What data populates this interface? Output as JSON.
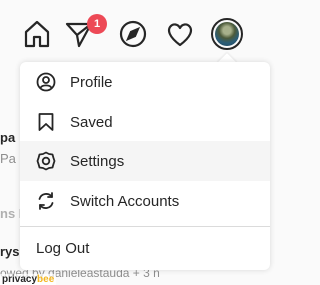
{
  "topbar": {
    "icons": [
      "home-icon",
      "direct-message-icon",
      "explore-compass-icon",
      "activity-heart-icon"
    ],
    "notification_count": "1",
    "accent_badge_color": "#ed4956"
  },
  "background_feed": {
    "name1": "pa",
    "sub1": "Pa",
    "suggestions_fragment": "ns F",
    "name2": "ryso",
    "sub2": "owed by danieleastauda + 3 n"
  },
  "menu": {
    "items": [
      {
        "label": "Profile",
        "icon": "profile-circle-icon"
      },
      {
        "label": "Saved",
        "icon": "bookmark-icon"
      },
      {
        "label": "Settings",
        "icon": "settings-gear-icon"
      },
      {
        "label": "Switch Accounts",
        "icon": "switch-accounts-icon"
      }
    ],
    "logout_label": "Log Out"
  },
  "watermark": {
    "part1": "privacy",
    "part2": "bee"
  }
}
